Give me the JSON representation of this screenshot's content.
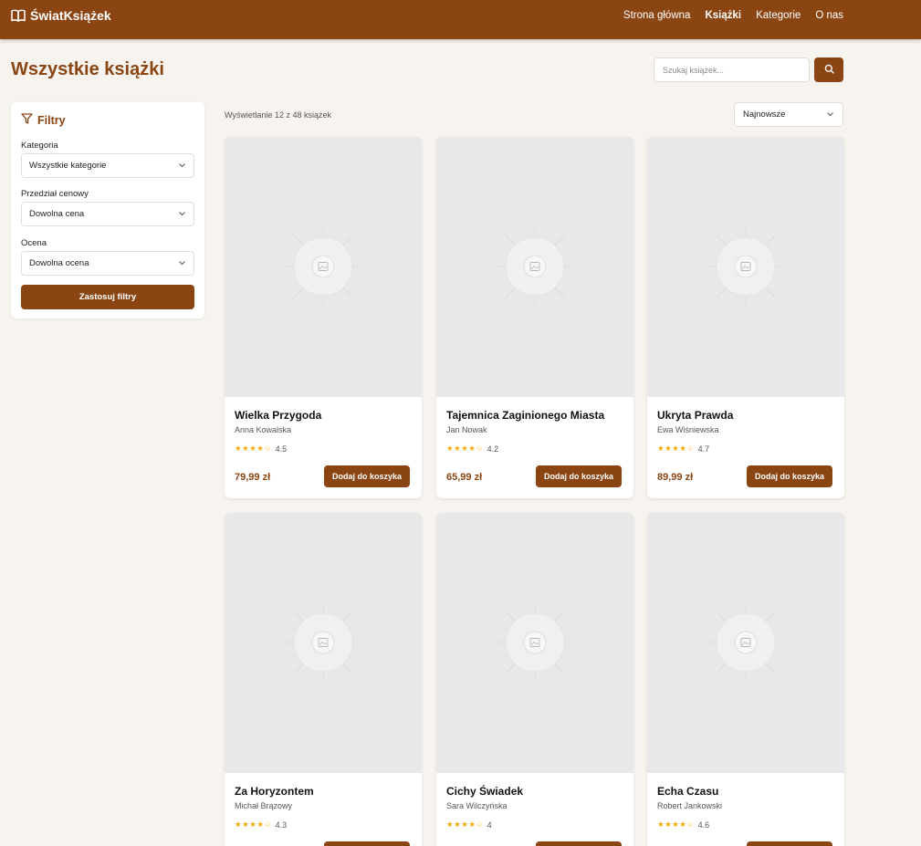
{
  "header": {
    "brand": "ŚwiatKsiążek",
    "nav": [
      {
        "label": "Strona główna",
        "active": false
      },
      {
        "label": "Książki",
        "active": true
      },
      {
        "label": "Kategorie",
        "active": false
      },
      {
        "label": "O nas",
        "active": false
      }
    ]
  },
  "page": {
    "title": "Wszystkie książki",
    "search_placeholder": "Szukaj książek..."
  },
  "filters": {
    "title": "Filtry",
    "category_label": "Kategoria",
    "category_value": "Wszystkie kategorie",
    "price_label": "Przedział cenowy",
    "price_value": "Dowolna cena",
    "rating_label": "Ocena",
    "rating_value": "Dowolna ocena",
    "apply_label": "Zastosuj filtry"
  },
  "results": {
    "count_text": "Wyświetlanie 12 z 48 książek",
    "sort_value": "Najnowsze"
  },
  "books": [
    {
      "title": "Wielka Przygoda",
      "author": "Anna Kowalska",
      "stars": "★★★★☆",
      "rating": "4.5",
      "price": "79,99 zł",
      "cart_label": "Dodaj do koszyka"
    },
    {
      "title": "Tajemnica Zaginionego Miasta",
      "author": "Jan Nowak",
      "stars": "★★★★☆",
      "rating": "4.2",
      "price": "65,99 zł",
      "cart_label": "Dodaj do koszyka"
    },
    {
      "title": "Ukryta Prawda",
      "author": "Ewa Wiśniewska",
      "stars": "★★★★☆",
      "rating": "4.7",
      "price": "89,99 zł",
      "cart_label": "Dodaj do koszyka"
    },
    {
      "title": "Za Horyzontem",
      "author": "Michał Brązowy",
      "stars": "★★★★☆",
      "rating": "4.3",
      "price": "",
      "cart_label": ""
    },
    {
      "title": "Cichy Świadek",
      "author": "Sara Wilczyńska",
      "stars": "★★★★☆",
      "rating": "4",
      "price": "",
      "cart_label": ""
    },
    {
      "title": "Echa Czasu",
      "author": "Robert Jankowski",
      "stars": "★★★★☆",
      "rating": "4.6",
      "price": "",
      "cart_label": ""
    }
  ],
  "colors": {
    "brand": "#8b4513",
    "background": "#f7f4ef",
    "star": "#f2a900"
  }
}
